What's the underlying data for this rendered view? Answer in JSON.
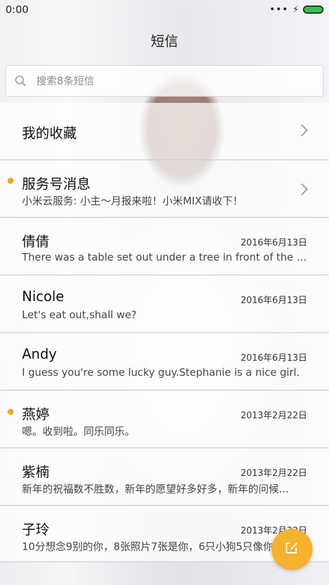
{
  "status_bar": {
    "time": "0:00",
    "more_icon": "dots-icon",
    "charging_icon": "bolt-icon",
    "battery_color": "#2ec84d"
  },
  "header": {
    "title": "短信"
  },
  "search": {
    "placeholder": "搜索8条短信"
  },
  "favorites": {
    "label": "我的收藏"
  },
  "service": {
    "label": "服务号消息",
    "preview": "小米云服务: 小主～月报来啦！小米MIX请收下！",
    "unread": true
  },
  "conversations": [
    {
      "name": "倩倩",
      "date": "2016年6月13日",
      "preview": "There was a table set out under a tree in front of the house...",
      "unread": false
    },
    {
      "name": "Nicole",
      "date": "2016年6月13日",
      "preview": "Let's eat out,shall we?",
      "unread": false
    },
    {
      "name": "Andy",
      "date": "2016年6月13日",
      "preview": "I guess you're some lucky guy.Stephanie is a nice girl.",
      "unread": false
    },
    {
      "name": "燕婷",
      "date": "2013年2月22日",
      "preview": "嗯。收到啦。同乐同乐。",
      "unread": true
    },
    {
      "name": "紫楠",
      "date": "2013年2月22日",
      "preview": "新年的祝福数不胜数，新年的愿望好多好多，新年的问候...",
      "unread": false
    },
    {
      "name": "子玲",
      "date": "2013年2月22日",
      "preview": "10分想念9别的你，8张照片7张是你，6只小狗5只像你...",
      "unread": false
    }
  ],
  "fab": {
    "icon": "compose-icon",
    "color": "#f6b12e"
  },
  "accent": {
    "unread_dot": "#f5a623"
  }
}
